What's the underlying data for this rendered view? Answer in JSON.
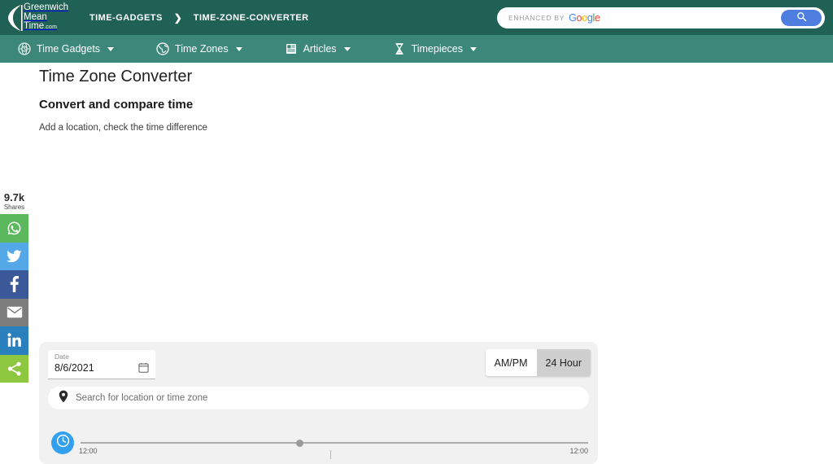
{
  "site": {
    "logo_line1": "Greenwich",
    "logo_line2": "Mean",
    "logo_line3": "Time",
    "logo_suffix": ".com",
    "header_bg": "#1f6154",
    "nav_bg": "#3c8779"
  },
  "breadcrumb": {
    "item1": "TIME-GADGETS",
    "separator": "❯",
    "item2": "TIME-ZONE-CONVERTER"
  },
  "search": {
    "enhanced_label": "ENHANCED BY",
    "brand_g": "G",
    "brand_o1": "o",
    "brand_o2": "o",
    "brand_g2": "g",
    "brand_l": "l",
    "brand_e": "e",
    "button_icon": "search-icon",
    "button_color": "#4e7fe0"
  },
  "nav": {
    "items": [
      {
        "label": "Time Gadgets",
        "icon": "globe-clock-icon",
        "has_caret": true
      },
      {
        "label": "Time Zones",
        "icon": "globe-icon",
        "has_caret": true
      },
      {
        "label": "Articles",
        "icon": "book-icon",
        "has_caret": true
      },
      {
        "label": "Timepieces",
        "icon": "hourglass-icon",
        "has_caret": true
      }
    ]
  },
  "main": {
    "title": "Time Zone Converter",
    "subtitle": "Convert and compare time",
    "description": "Add a location, check the time difference"
  },
  "share_rail": {
    "count": "9.7k",
    "count_label": "Shares",
    "buttons": [
      {
        "name": "whatsapp",
        "icon": "whatsapp-icon",
        "color": "#5cb85c"
      },
      {
        "name": "twitter",
        "icon": "twitter-icon",
        "color": "#55a8e8"
      },
      {
        "name": "facebook",
        "icon": "facebook-icon",
        "color": "#3b5998"
      },
      {
        "name": "email",
        "icon": "email-icon",
        "color": "#7d7d7d"
      },
      {
        "name": "linkedin",
        "icon": "linkedin-icon",
        "color": "#2a7fbd"
      },
      {
        "name": "share",
        "icon": "share-icon",
        "color": "#8dc63f"
      }
    ]
  },
  "converter": {
    "date_label": "Date",
    "date_value": "8/6/2021",
    "calendar_icon": "calendar-icon",
    "format_ampm": "AM/PM",
    "format_24h": "24 Hour",
    "format_selected": "AM/PM",
    "location_placeholder": "Search for location or time zone",
    "location_icon": "map-pin-icon",
    "clock_icon": "clock-icon",
    "slider_start_label": "12:00",
    "slider_end_label": "12:00",
    "slider_percent": 48
  }
}
